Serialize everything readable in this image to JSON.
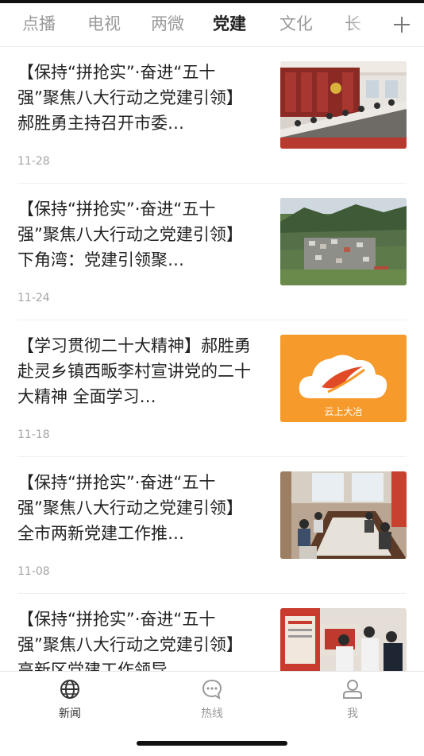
{
  "tabs": [
    "点播",
    "电视",
    "两微",
    "党建",
    "文化",
    "长"
  ],
  "active_tab_index": 3,
  "add_tab_icon": "plus-icon",
  "articles": [
    {
      "title": "【保持“拼抢实”·奋进“五十强”聚焦八大行动之党建引领】郝胜勇主持召开市委…",
      "date": "11-28",
      "image": "meeting-room-photo"
    },
    {
      "title": "【保持“拼抢实”·奋进“五十强”聚焦八大行动之党建引领】下角湾：党建引领聚…",
      "date": "11-24",
      "image": "village-aerial-photo"
    },
    {
      "title": "【学习贯彻二十大精神】郝胜勇赴灵乡镇西畈李村宣讲党的二十大精神 全面学习…",
      "date": "11-18",
      "image": "app-logo-placeholder",
      "logo_text": "云上大冶"
    },
    {
      "title": "【保持“拼抢实”·奋进“五十强”聚焦八大行动之党建引领】全市两新党建工作推…",
      "date": "11-08",
      "image": "conference-table-photo"
    },
    {
      "title": "【保持“拼抢实”·奋进“五十强”聚焦八大行动之党建引领】高新区党建工作领导…",
      "date": "",
      "image": "exhibition-visit-photo"
    }
  ],
  "bottom_nav": [
    {
      "label": "新闻",
      "icon": "globe-icon"
    },
    {
      "label": "热线",
      "icon": "chat-bubble-icon"
    },
    {
      "label": "我",
      "icon": "user-icon"
    }
  ],
  "colors": {
    "active_text": "#222222",
    "inactive_text": "#9a9a9a",
    "date_text": "#a6a6a6",
    "logo_orange": "#f59a2b"
  }
}
